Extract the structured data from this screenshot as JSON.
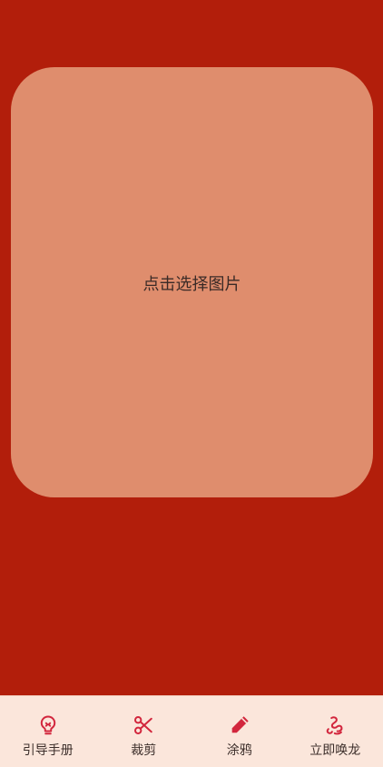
{
  "picker": {
    "label": "点击选择图片"
  },
  "tabs": [
    {
      "label": "引导手册",
      "icon": "lightbulb-icon"
    },
    {
      "label": "裁剪",
      "icon": "scissors-icon"
    },
    {
      "label": "涂鸦",
      "icon": "pencil-icon"
    },
    {
      "label": "立即唤龙",
      "icon": "dragon-squiggle-icon"
    }
  ],
  "colors": {
    "background": "#b21e0b",
    "picker_background": "#df8d6d",
    "tabbar_background": "#fbe6db",
    "icon_accent": "#d2263d"
  }
}
